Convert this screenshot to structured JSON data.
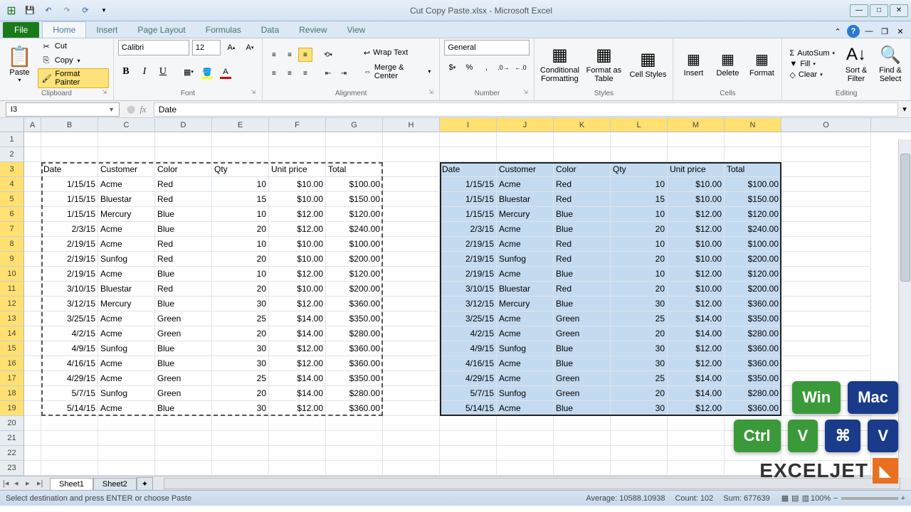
{
  "title": "Cut Copy Paste.xlsx - Microsoft Excel",
  "tabs": {
    "file": "File",
    "home": "Home",
    "insert": "Insert",
    "page_layout": "Page Layout",
    "formulas": "Formulas",
    "data": "Data",
    "review": "Review",
    "view": "View"
  },
  "ribbon": {
    "clipboard": {
      "label": "Clipboard",
      "paste": "Paste",
      "cut": "Cut",
      "copy": "Copy",
      "format_painter": "Format Painter"
    },
    "font": {
      "label": "Font",
      "name": "Calibri",
      "size": "12"
    },
    "alignment": {
      "label": "Alignment",
      "wrap": "Wrap Text",
      "merge": "Merge & Center"
    },
    "number": {
      "label": "Number",
      "format": "General"
    },
    "styles": {
      "label": "Styles",
      "conditional": "Conditional Formatting",
      "format_table": "Format as Table",
      "cell_styles": "Cell Styles"
    },
    "cells": {
      "label": "Cells",
      "insert": "Insert",
      "delete": "Delete",
      "format": "Format"
    },
    "editing": {
      "label": "Editing",
      "autosum": "AutoSum",
      "fill": "Fill",
      "clear": "Clear",
      "sort": "Sort & Filter",
      "find": "Find & Select"
    }
  },
  "name_box": "I3",
  "formula_value": "Date",
  "columns": [
    "A",
    "B",
    "C",
    "D",
    "E",
    "F",
    "G",
    "H",
    "I",
    "J",
    "K",
    "L",
    "M",
    "N",
    "O"
  ],
  "selected_cols": [
    "I",
    "J",
    "K",
    "L",
    "M",
    "N"
  ],
  "headers": [
    "Date",
    "Customer",
    "Color",
    "Qty",
    "Unit price",
    "Total"
  ],
  "rows": [
    {
      "date": "1/15/15",
      "customer": "Acme",
      "color": "Red",
      "qty": 10,
      "unit": "$10.00",
      "total": "$100.00"
    },
    {
      "date": "1/15/15",
      "customer": "Bluestar",
      "color": "Red",
      "qty": 15,
      "unit": "$10.00",
      "total": "$150.00"
    },
    {
      "date": "1/15/15",
      "customer": "Mercury",
      "color": "Blue",
      "qty": 10,
      "unit": "$12.00",
      "total": "$120.00"
    },
    {
      "date": "2/3/15",
      "customer": "Acme",
      "color": "Blue",
      "qty": 20,
      "unit": "$12.00",
      "total": "$240.00"
    },
    {
      "date": "2/19/15",
      "customer": "Acme",
      "color": "Red",
      "qty": 10,
      "unit": "$10.00",
      "total": "$100.00"
    },
    {
      "date": "2/19/15",
      "customer": "Sunfog",
      "color": "Red",
      "qty": 20,
      "unit": "$10.00",
      "total": "$200.00"
    },
    {
      "date": "2/19/15",
      "customer": "Acme",
      "color": "Blue",
      "qty": 10,
      "unit": "$12.00",
      "total": "$120.00"
    },
    {
      "date": "3/10/15",
      "customer": "Bluestar",
      "color": "Red",
      "qty": 20,
      "unit": "$10.00",
      "total": "$200.00"
    },
    {
      "date": "3/12/15",
      "customer": "Mercury",
      "color": "Blue",
      "qty": 30,
      "unit": "$12.00",
      "total": "$360.00"
    },
    {
      "date": "3/25/15",
      "customer": "Acme",
      "color": "Green",
      "qty": 25,
      "unit": "$14.00",
      "total": "$350.00"
    },
    {
      "date": "4/2/15",
      "customer": "Acme",
      "color": "Green",
      "qty": 20,
      "unit": "$14.00",
      "total": "$280.00"
    },
    {
      "date": "4/9/15",
      "customer": "Sunfog",
      "color": "Blue",
      "qty": 30,
      "unit": "$12.00",
      "total": "$360.00"
    },
    {
      "date": "4/16/15",
      "customer": "Acme",
      "color": "Blue",
      "qty": 30,
      "unit": "$12.00",
      "total": "$360.00"
    },
    {
      "date": "4/29/15",
      "customer": "Acme",
      "color": "Green",
      "qty": 25,
      "unit": "$14.00",
      "total": "$350.00"
    },
    {
      "date": "5/7/15",
      "customer": "Sunfog",
      "color": "Green",
      "qty": 20,
      "unit": "$14.00",
      "total": "$280.00"
    },
    {
      "date": "5/14/15",
      "customer": "Acme",
      "color": "Blue",
      "qty": 30,
      "unit": "$12.00",
      "total": "$360.00"
    }
  ],
  "sheets": {
    "s1": "Sheet1",
    "s2": "Sheet2"
  },
  "status": {
    "msg": "Select destination and press ENTER or choose Paste",
    "avg_label": "Average:",
    "avg": "10588.10938",
    "count_label": "Count:",
    "count": "102",
    "sum_label": "Sum:",
    "sum": "677639",
    "zoom": "100%"
  },
  "badges": {
    "win": "Win",
    "mac": "Mac",
    "ctrl": "Ctrl",
    "v1": "V",
    "cmd": "⌘",
    "v2": "V",
    "brand": "EXCELJET"
  }
}
